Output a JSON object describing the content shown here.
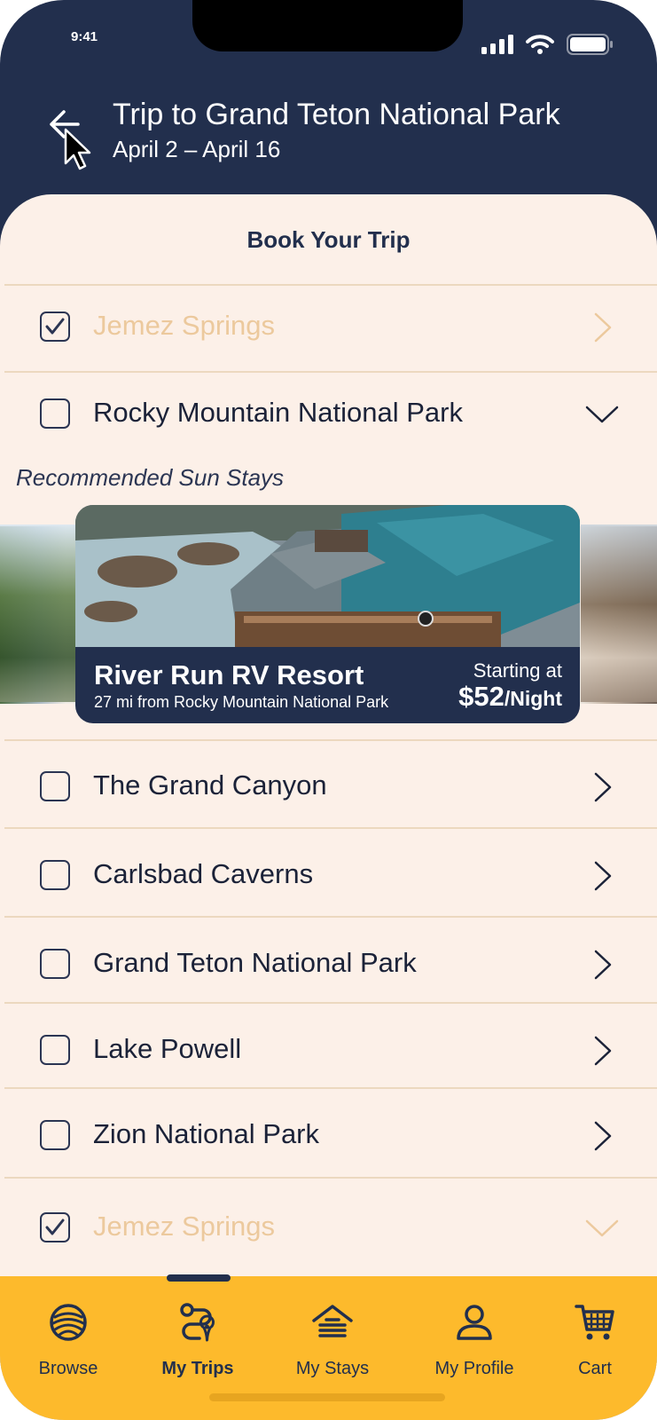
{
  "status_bar": {
    "time": "9:41"
  },
  "header": {
    "title": "Trip to Grand Teton National Park",
    "dates": "April 2 – April 16"
  },
  "sheet": {
    "title": "Book Your Trip"
  },
  "destinations_top": [
    {
      "label": "Jemez Springs",
      "checked": true,
      "chevron": "right"
    },
    {
      "label": "Rocky Mountain National Park",
      "checked": false,
      "chevron": "down"
    }
  ],
  "recommended": {
    "label": "Recommended Sun Stays",
    "card": {
      "name": "River Run RV Resort",
      "distance": "27 mi from Rocky Mountain National Park",
      "starting_label": "Starting at",
      "price": "$52",
      "price_unit": "/Night"
    }
  },
  "destinations": [
    {
      "label": "The Grand Canyon",
      "checked": false,
      "chevron": "right"
    },
    {
      "label": "Carlsbad Caverns",
      "checked": false,
      "chevron": "right"
    },
    {
      "label": "Grand Teton National Park",
      "checked": false,
      "chevron": "right"
    },
    {
      "label": "Lake Powell",
      "checked": false,
      "chevron": "right"
    },
    {
      "label": "Zion National Park",
      "checked": false,
      "chevron": "right"
    },
    {
      "label": "Jemez Springs",
      "checked": true,
      "chevron": "down"
    }
  ],
  "tabs": [
    {
      "label": "Browse",
      "icon": "globe-icon",
      "active": false
    },
    {
      "label": "My Trips",
      "icon": "route-icon",
      "active": true
    },
    {
      "label": "My Stays",
      "icon": "house-icon",
      "active": false
    },
    {
      "label": "My Profile",
      "icon": "person-icon",
      "active": false
    },
    {
      "label": "Cart",
      "icon": "cart-icon",
      "active": false
    }
  ],
  "colors": {
    "navy": "#222f4d",
    "cream": "#fcf0e8",
    "gold": "#fdba2c",
    "muted_label": "#ecc99d",
    "divider": "#ecd8bf"
  }
}
